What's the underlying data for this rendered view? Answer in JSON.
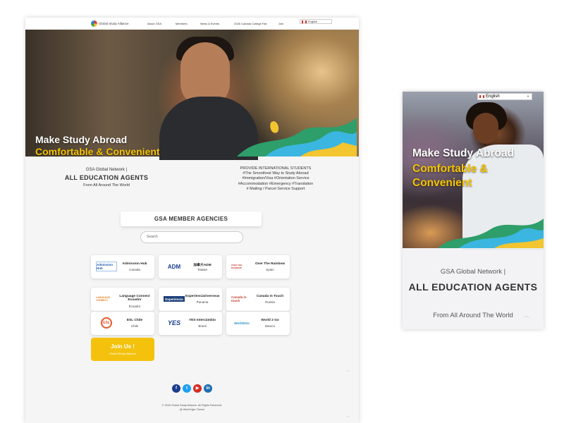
{
  "desktop": {
    "nav": {
      "logo_text": "Global Study Alliance",
      "items": [
        "About GSA",
        "Members",
        "News & Events",
        "2026 Canada College Fair",
        "Join"
      ],
      "language": "English"
    },
    "hero": {
      "line1": "Make Study Abroad",
      "line2": "Comfortable & Convenient"
    },
    "info_left": {
      "line1": "GSA Global Network |",
      "line2": "ALL EDUCATION AGENTS",
      "line3": "From All Around The World"
    },
    "info_right": {
      "lines": [
        "PROVIDE INTERNATIONAL STUDENTS",
        "#The Smoothest Way to Study Abroad",
        "#Immigration/Visa #Orientation Service",
        "#Accommodation #Emergency #Translation",
        "# Mailing / Parcel Service Support"
      ]
    },
    "members": {
      "title": "GSA MEMBER AGENCIES",
      "search_placeholder": "Search",
      "cards": [
        {
          "name": "Admission Hub",
          "country": "Canada",
          "logo": "Admission Hub"
        },
        {
          "name": "加拿大ADM",
          "country": "Taiwan",
          "logo": "ADM"
        },
        {
          "name": "Over The Rainbow",
          "country": "Spain",
          "logo": "OVER THE RAINBOW"
        },
        {
          "name": "Language Connect Ecuador",
          "country": "Ecuador",
          "logo": "LANGUAGE CONNECT"
        },
        {
          "name": "ExperienciaOverseas",
          "country": "Panama",
          "logo": "Experiencia"
        },
        {
          "name": "Canada In Touch",
          "country": "Russia",
          "logo": "Canada in touch"
        },
        {
          "name": "ESL Chile",
          "country": "Chile",
          "logo": "ESL"
        },
        {
          "name": "YES Intercâmbio",
          "country": "Brasil",
          "logo": "YES"
        },
        {
          "name": "World 2 Go",
          "country": "Mexico",
          "logo": "World2Go"
        }
      ],
      "join": {
        "label": "Join Us !",
        "sub": "Global Study Alliance"
      }
    },
    "social": [
      "facebook-icon",
      "twitter-icon",
      "youtube-icon",
      "linkedin-icon"
    ],
    "footer": {
      "line1": "© 2026 Global Study Alliance. All Rights Reserved.",
      "line2": "@ WebOrigin Theme"
    }
  },
  "mobile": {
    "language": "English",
    "hero": {
      "line1": "Make Study Abroad",
      "line2": "Comfortable & Convenient"
    },
    "info": {
      "line1": "GSA Global Network |",
      "line2": "ALL EDUCATION AGENTS",
      "line3": "From All Around The World"
    }
  },
  "colors": {
    "accent_yellow": "#f4c20d",
    "text_dark": "#333333",
    "page_bg": "#f5f5f6"
  }
}
